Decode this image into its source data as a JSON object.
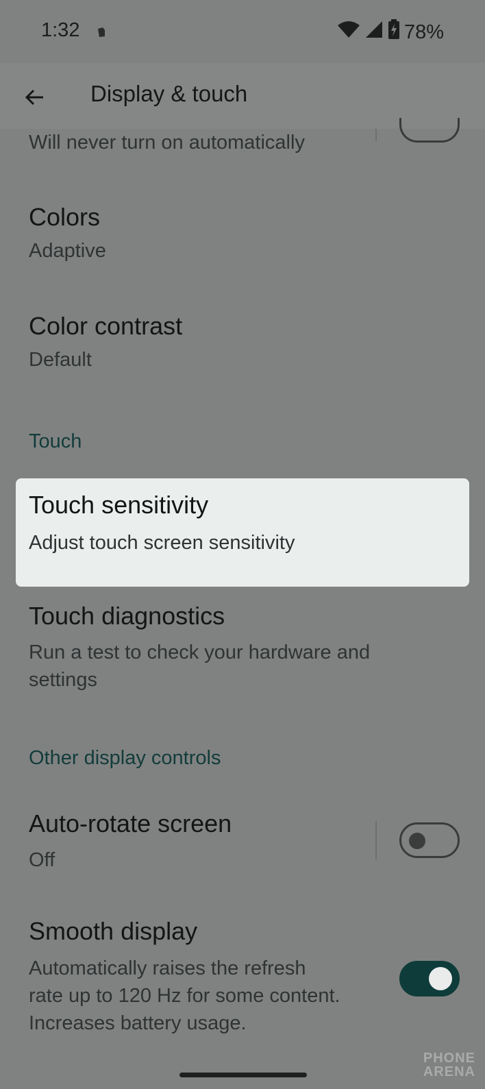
{
  "status_bar": {
    "time": "1:32",
    "battery": "78%",
    "icons": [
      "notification-icon",
      "wifi-icon",
      "cell-signal-icon",
      "battery-charging-icon"
    ]
  },
  "app_bar": {
    "title": "Display & touch"
  },
  "items": {
    "partial_top": {
      "subtitle": "Will never turn on automatically"
    },
    "colors": {
      "title": "Colors",
      "subtitle": "Adaptive"
    },
    "color_contrast": {
      "title": "Color contrast",
      "subtitle": "Default"
    },
    "touch_header": "Touch",
    "touch_sensitivity": {
      "title": "Touch sensitivity",
      "subtitle": "Adjust touch screen sensitivity"
    },
    "touch_diagnostics": {
      "title": "Touch diagnostics",
      "subtitle_line1": "Run a test to check your hardware and",
      "subtitle_line2": "settings"
    },
    "other_header": "Other display controls",
    "auto_rotate": {
      "title": "Auto-rotate screen",
      "subtitle": "Off",
      "toggle_on": false
    },
    "smooth_display": {
      "title": "Smooth display",
      "subtitle_line1": "Automatically raises the refresh",
      "subtitle_line2": "rate up to 120 Hz for some content.",
      "subtitle_line3": "Increases battery usage.",
      "toggle_on": true
    }
  },
  "watermark": {
    "line1": "PHONE",
    "line2": "ARENA"
  },
  "colors": {
    "background": "#808281",
    "highlight": "#eaeeed",
    "accent": "#0e3c3a"
  }
}
